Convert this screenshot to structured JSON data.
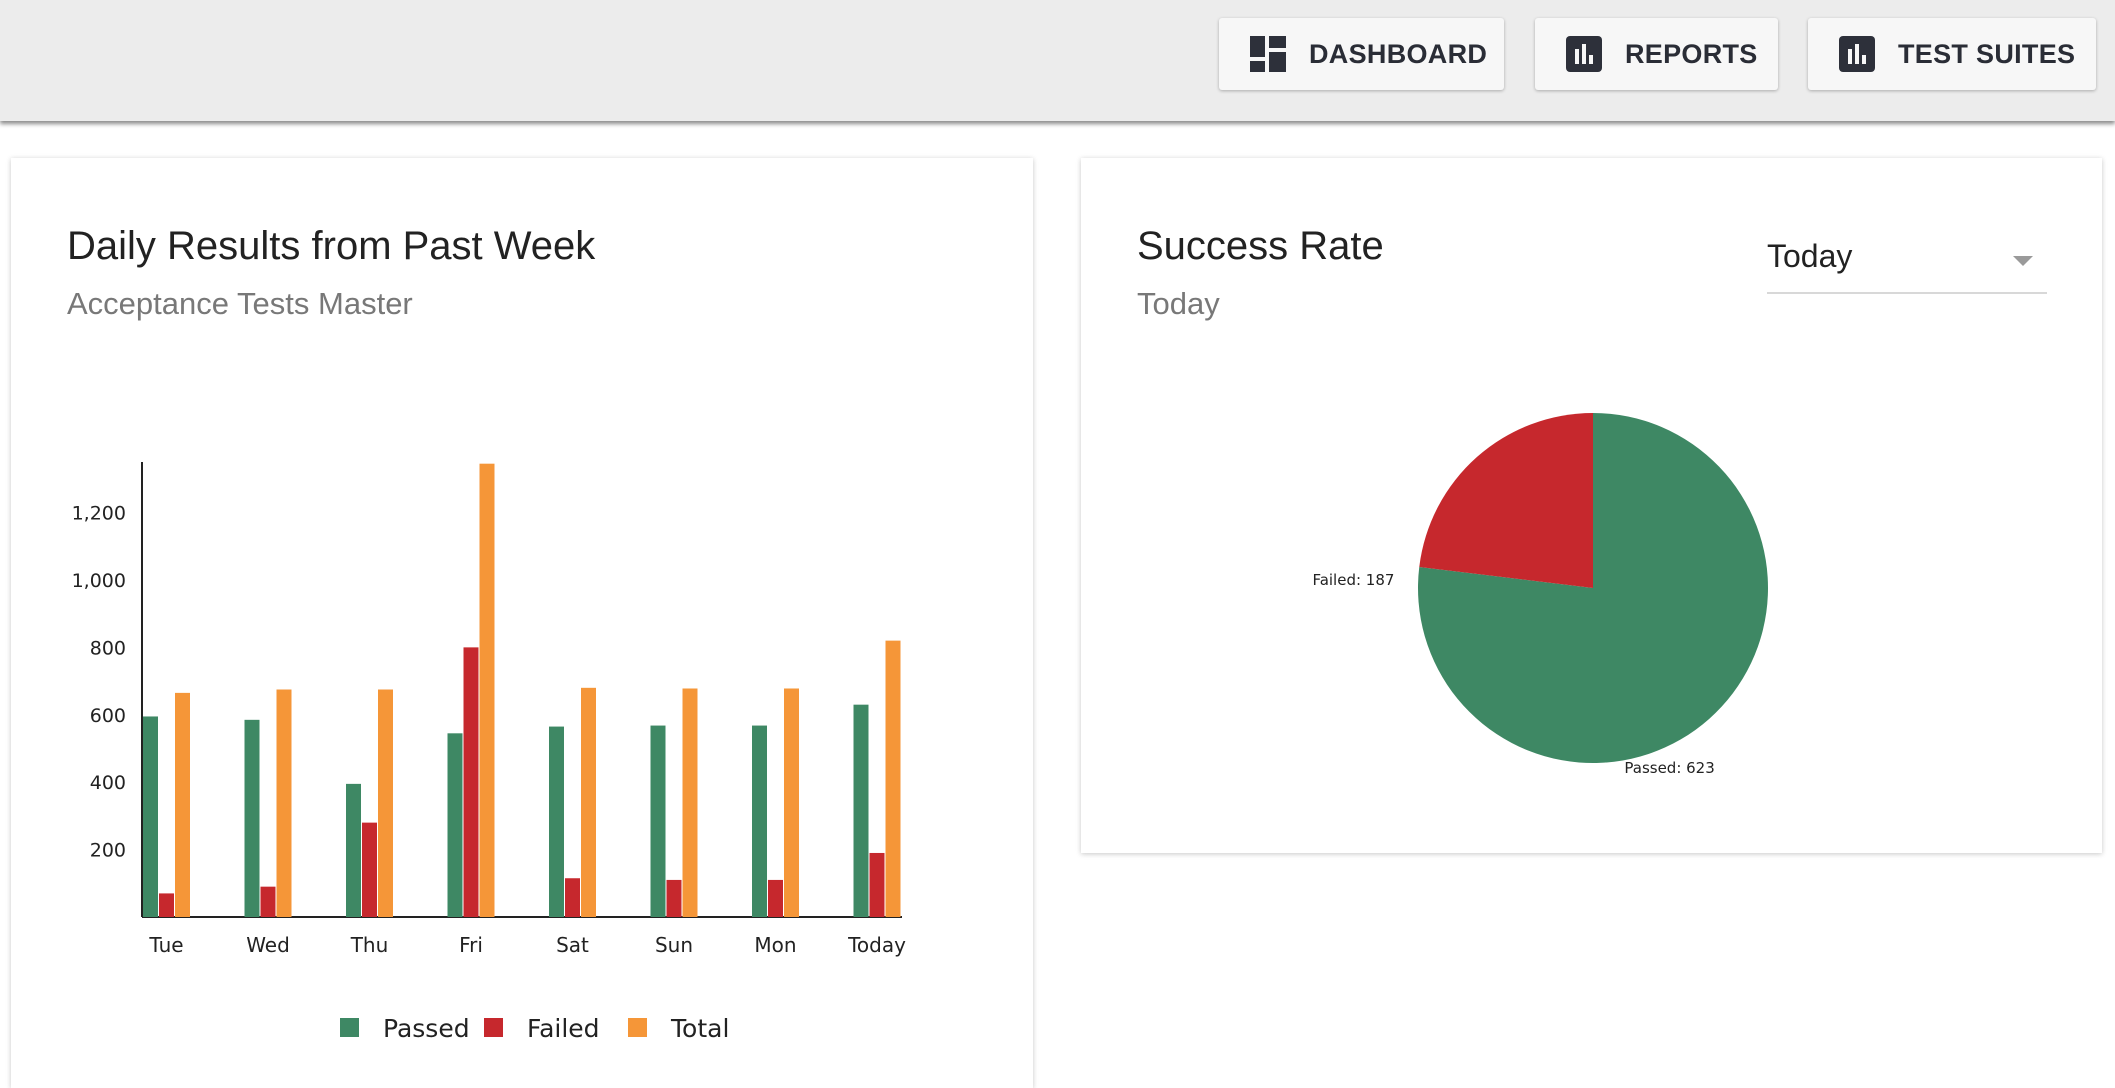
{
  "nav": {
    "buttons": [
      {
        "label": "DASHBOARD",
        "icon": "dashboard-icon"
      },
      {
        "label": "REPORTS",
        "icon": "bar-chart-icon"
      },
      {
        "label": "TEST SUITES",
        "icon": "bar-chart-icon"
      }
    ]
  },
  "daily_card": {
    "title": "Daily Results from Past Week",
    "subtitle": "Acceptance Tests Master"
  },
  "success_card": {
    "title": "Success Rate",
    "subtitle": "Today",
    "period_select": {
      "value": "Today"
    }
  },
  "colors": {
    "passed": "#3e8864",
    "failed": "#c6282d",
    "total": "#f59638",
    "nav_icon": "#2d303a"
  },
  "chart_data": [
    {
      "type": "bar",
      "title": "",
      "xlabel": "",
      "ylabel": "",
      "categories": [
        "Tue",
        "Wed",
        "Thu",
        "Fri",
        "Sat",
        "Sun",
        "Mon",
        "Today"
      ],
      "series": [
        {
          "name": "Passed",
          "values": [
            595,
            585,
            395,
            545,
            565,
            568,
            568,
            630
          ]
        },
        {
          "name": "Failed",
          "values": [
            70,
            90,
            280,
            800,
            115,
            110,
            110,
            190
          ]
        },
        {
          "name": "Total",
          "values": [
            665,
            675,
            675,
            1345,
            680,
            678,
            678,
            820
          ]
        }
      ],
      "ylim": [
        0,
        1350
      ],
      "yticks": [
        200,
        400,
        600,
        800,
        1000,
        1200
      ],
      "ytick_labels": [
        "200",
        "400",
        "600",
        "800",
        "1,000",
        "1,200"
      ],
      "legend": "bottom",
      "grid": false
    },
    {
      "type": "pie",
      "title": "",
      "slices": [
        {
          "name": "Passed",
          "value": 623,
          "label": "Passed: 623"
        },
        {
          "name": "Failed",
          "value": 187,
          "label": "Failed: 187"
        }
      ]
    }
  ]
}
